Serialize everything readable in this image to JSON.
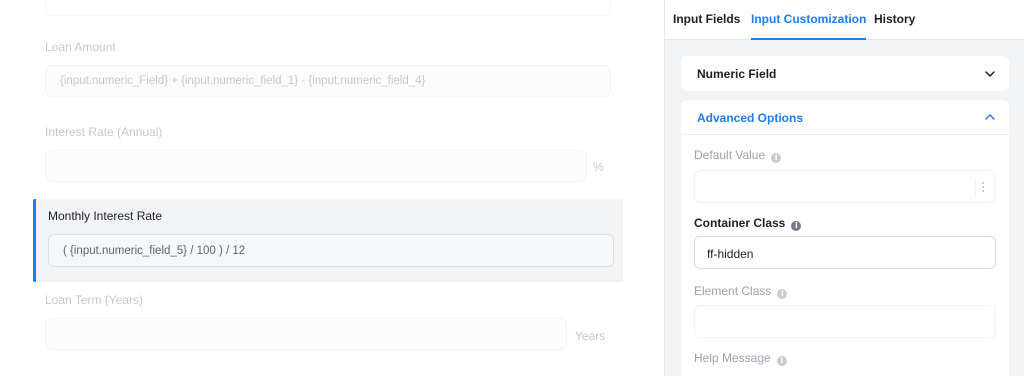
{
  "canvas": {
    "loan_amount": {
      "label": "Loan Amount",
      "formula": "{input.numeric_Field} + {input.numeric_field_1} - {input.numeric_field_4}"
    },
    "interest_rate": {
      "label": "Interest Rate (Annual)",
      "suffix": "%"
    },
    "monthly_interest_rate": {
      "label": "Monthly Interest Rate",
      "formula": "( {input.numeric_field_5} / 100 ) / 12"
    },
    "loan_term": {
      "label": "Loan Term (Years)",
      "suffix": "Years"
    }
  },
  "panel": {
    "tabs": [
      {
        "label": "Input Fields"
      },
      {
        "label": "Input Customization"
      },
      {
        "label": "History"
      }
    ],
    "numeric_section": {
      "title": "Numeric Field"
    },
    "advanced_section": {
      "title": "Advanced Options",
      "default_value_label": "Default Value",
      "container_class_label": "Container Class",
      "container_class_value": "ff-hidden",
      "element_class_label": "Element Class",
      "help_message_label": "Help Message"
    }
  },
  "colors": {
    "accent": "#1a7efb",
    "panel_bg": "#f2f3f5",
    "selected_bg": "#f2f3f5"
  },
  "icons": {
    "collapse": "chevron-down-icon",
    "expand": "chevron-up-icon",
    "info": "info-icon",
    "more": "kebab-menu-icon"
  }
}
